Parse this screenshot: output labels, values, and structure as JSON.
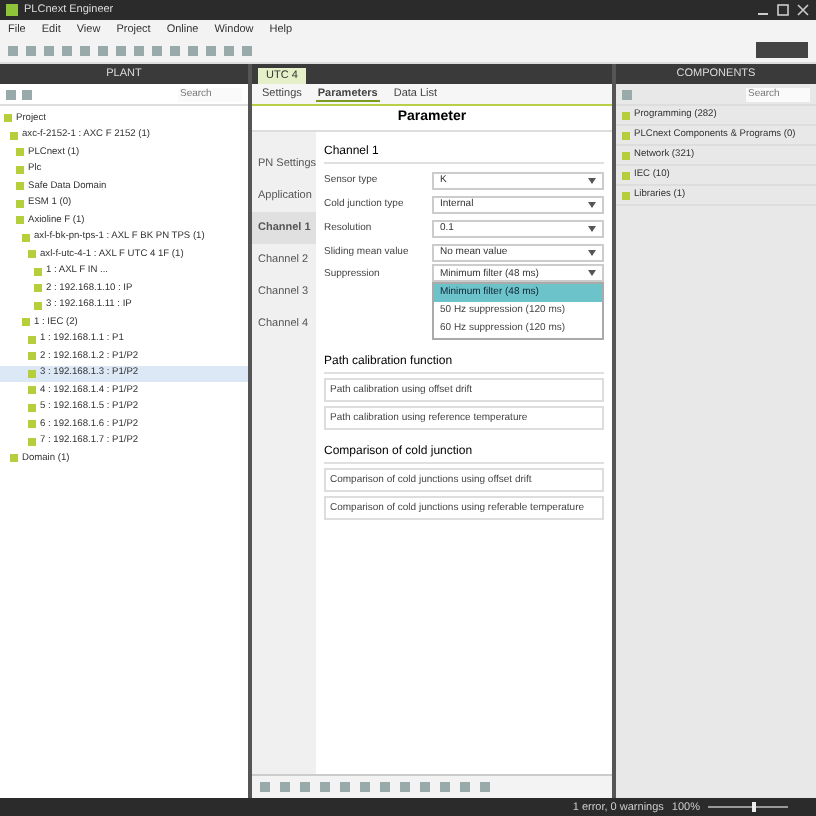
{
  "window": {
    "title": "PLCnext Engineer"
  },
  "menu": [
    "File",
    "Edit",
    "View",
    "Project",
    "Online",
    "Window",
    "Help"
  ],
  "plant": {
    "title": "PLANT",
    "search_placeholder": "Search",
    "tree": [
      {
        "label": "Project",
        "selected": false,
        "children": [
          {
            "label": "axc-f-2152-1 : AXC F 2152 (1)",
            "selected": false,
            "children": [
              {
                "label": "PLCnext (1)",
                "selected": false
              },
              {
                "label": "Plc",
                "selected": false
              },
              {
                "label": "Safe Data Domain",
                "selected": false
              },
              {
                "label": "ESM 1 (0)",
                "selected": false
              },
              {
                "label": "Axioline F (1)",
                "selected": false,
                "children": [
                  {
                    "label": "axl-f-bk-pn-tps-1 : AXL F BK PN TPS (1)",
                    "selected": false,
                    "children": [
                      {
                        "label": "axl-f-utc-4-1 : AXL F UTC 4 1F (1)",
                        "selected": false,
                        "children": [
                          {
                            "label": "1 : AXL F IN ...",
                            "selected": false
                          },
                          {
                            "label": "2 : 192.168.1.10 : IP",
                            "selected": false
                          },
                          {
                            "label": "3 : 192.168.1.11 : IP",
                            "selected": false
                          }
                        ]
                      }
                    ]
                  },
                  {
                    "label": "1 : IEC (2)",
                    "selected": false,
                    "children": [
                      {
                        "label": "1 : 192.168.1.1 : P1",
                        "selected": false
                      },
                      {
                        "label": "2 : 192.168.1.2 : P1/P2",
                        "selected": false
                      },
                      {
                        "label": "3 : 192.168.1.3 : P1/P2",
                        "selected": true
                      },
                      {
                        "label": "4 : 192.168.1.4 : P1/P2",
                        "selected": false
                      },
                      {
                        "label": "5 : 192.168.1.5 : P1/P2",
                        "selected": false
                      },
                      {
                        "label": "6 : 192.168.1.6 : P1/P2",
                        "selected": false
                      },
                      {
                        "label": "7 : 192.168.1.7 : P1/P2",
                        "selected": false
                      }
                    ]
                  }
                ]
              }
            ]
          },
          {
            "label": "Domain (1)",
            "selected": false
          }
        ]
      }
    ]
  },
  "editor": {
    "tab": "UTC 4",
    "subtabs": [
      {
        "label": "Settings",
        "selected": false
      },
      {
        "label": "Parameters",
        "selected": true
      },
      {
        "label": "Data List",
        "selected": false
      }
    ],
    "header": "Parameter",
    "nav": [
      {
        "label": "PN Settings",
        "selected": false
      },
      {
        "label": "Application",
        "selected": false
      },
      {
        "label": "Channel 1",
        "selected": true
      },
      {
        "label": "Channel 2",
        "selected": false
      },
      {
        "label": "Channel 3",
        "selected": false
      },
      {
        "label": "Channel 4",
        "selected": false
      }
    ],
    "section": "Channel 1",
    "params": [
      {
        "label": "Sensor type",
        "value": "K"
      },
      {
        "label": "Cold junction type",
        "value": "Internal"
      },
      {
        "label": "Resolution",
        "value": "0.1"
      },
      {
        "label": "Sliding mean value",
        "value": "No mean value"
      },
      {
        "label": "Suppression",
        "value": "Minimum filter (48 ms)"
      }
    ],
    "dropdown": [
      {
        "label": "Minimum filter (48 ms)",
        "selected": true
      },
      {
        "label": "50 Hz suppression (120 ms)",
        "selected": false
      },
      {
        "label": "60 Hz suppression (120 ms)",
        "selected": false
      }
    ],
    "groups": [
      {
        "title": "Path calibration function",
        "items": [
          "Path calibration using offset drift",
          "Path calibration using reference temperature"
        ]
      },
      {
        "title": "Comparison of cold junction",
        "items": [
          "Comparison of cold junctions using offset drift",
          "Comparison of cold junctions using referable temperature"
        ]
      }
    ]
  },
  "components": {
    "title": "COMPONENTS",
    "search_placeholder": "Search",
    "items": [
      "Programming (282)",
      "PLCnext Components & Programs (0)",
      "Network (321)",
      "IEC (10)",
      "Libraries (1)"
    ]
  },
  "status_bar": {
    "text": "1 error, 0 warnings",
    "zoom": "100%",
    "level": 0.55
  }
}
